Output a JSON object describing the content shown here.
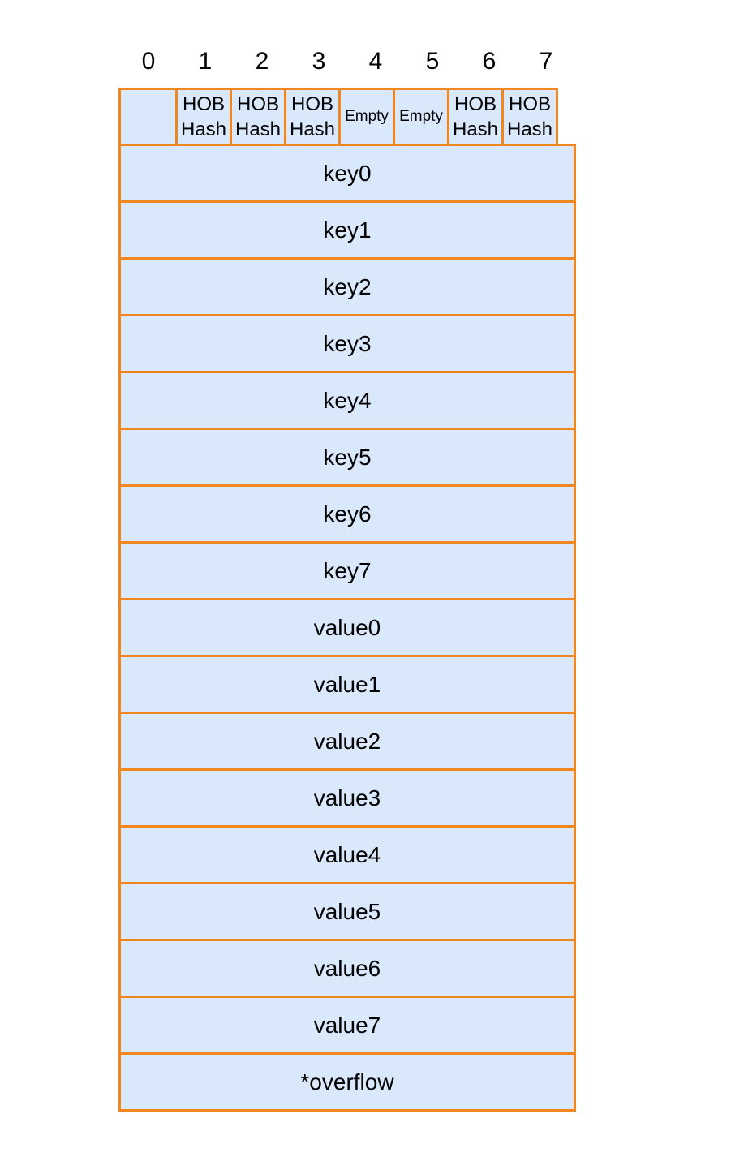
{
  "columns": [
    "0",
    "1",
    "2",
    "3",
    "4",
    "5",
    "6",
    "7"
  ],
  "tophash": [
    {
      "lines": [],
      "color": "#dae8fc"
    },
    {
      "lines": [
        "HOB",
        "Hash"
      ]
    },
    {
      "lines": [
        "HOB",
        "Hash"
      ]
    },
    {
      "lines": [
        "HOB",
        "Hash"
      ]
    },
    {
      "lines": [
        "Empty"
      ],
      "empty": true
    },
    {
      "lines": [
        "Empty"
      ],
      "empty": true
    },
    {
      "lines": [
        "HOB",
        "Hash"
      ]
    },
    {
      "lines": [
        "HOB",
        "Hash"
      ]
    }
  ],
  "rows": [
    "key0",
    "key1",
    "key2",
    "key3",
    "key4",
    "key5",
    "key6",
    "key7",
    "value0",
    "value1",
    "value2",
    "value3",
    "value4",
    "value5",
    "value6",
    "value7",
    "*overflow"
  ],
  "colors": {
    "fill": "#dae8fc",
    "border": "#f2861e"
  }
}
